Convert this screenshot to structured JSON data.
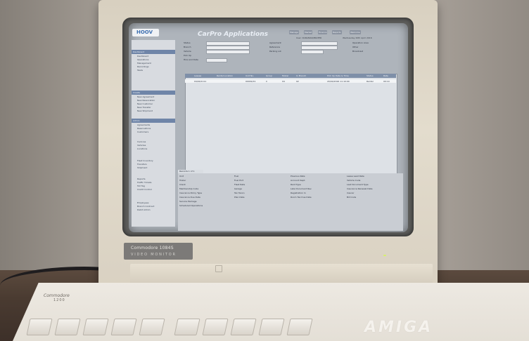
{
  "monitor": {
    "brand": "Commodore 1084S",
    "model_label": "VIDEO MONITOR"
  },
  "keyboard": {
    "wordmark": "AMIGA",
    "badge": "Commodore",
    "model_no": "1200"
  },
  "screen_app": {
    "logo": "HOOV",
    "title": "CarPro Applications",
    "date": "Wednesday 20th April 2016",
    "tabs": [
      "Manage",
      "Market",
      "Finance",
      "Reports",
      "Welcome"
    ],
    "user": "User: KURAMAN/PRATER",
    "sidebar_sections": [
      {
        "title": "Dashboard",
        "items": [
          "Dashboard",
          "Operations",
          "Management",
          "Recordings",
          "Tasks"
        ]
      },
      {
        "title": "Create",
        "items": [
          "New Agreement",
          "New Reservation",
          "New Customer",
          "New Transfer",
          "New Shipment"
        ]
      },
      {
        "title": "Admin",
        "items": [
          "Agreements",
          "Reservations",
          "Customers",
          "Invoices",
          "Vehicles",
          "Locations",
          "Fleet Inventory",
          "Transfers",
          "Shipment",
          "Reports",
          "Traffic Tickets",
          "Toll Tag",
          "Credit Control",
          "Employees",
          "Branch Contract",
          "Debit Admin"
        ]
      }
    ],
    "filter_labels": [
      "Status",
      "Branch",
      "Vehicle",
      "Pick Up",
      "Hire and Date",
      "Agreement",
      "Reference",
      "Parking Lot",
      "Operation Area",
      "Other",
      "Broadcast"
    ],
    "grid_headers": [
      "Lessee",
      "Rental Location",
      "Unit No.",
      "Group",
      "Model",
      "In Branch",
      "Pick Up Date & Time",
      "Status",
      "Rate"
    ],
    "grid_row": [
      "04/04/1111",
      "",
      "00001/01",
      "C",
      "04",
      "02",
      "20/04/2016 11:10:00",
      "Rental",
      "00:10"
    ],
    "detail_tab": "Records 1 of 1",
    "detail_labels": [
      "Unit",
      "Trailer",
      "Client",
      "Membership Code",
      "Insurance Policy Type",
      "Insurance Due Date",
      "Service Package",
      "Scheduled Operations",
      "Fuel",
      "Fuel Port",
      "Fleet Rate",
      "Garage",
      "Tax Taxon",
      "Plan Date",
      "Previous Rate",
      "Account Dept.",
      "Rent Type",
      "Late Document Rev.",
      "Registration In",
      "Room Tax Due Date",
      "Lease Lead Rate",
      "Vehicle Code",
      "Last Document Type",
      "Insurance Renewal Date",
      "Insurer",
      "Bill Code"
    ]
  }
}
